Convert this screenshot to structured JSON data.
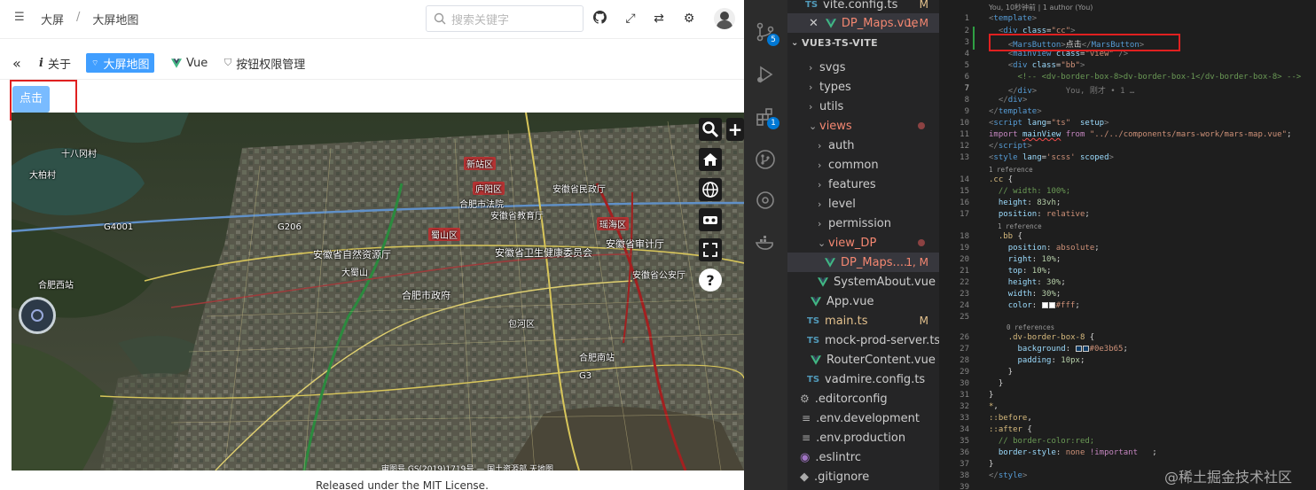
{
  "app": {
    "breadcrumb": [
      "大屏",
      "大屏地图"
    ],
    "search_placeholder": "搜索关键字",
    "tabs": [
      {
        "label": "关于",
        "icon": "info-icon"
      },
      {
        "label": "大屏地图",
        "icon": "dashboard-icon",
        "active": true
      },
      {
        "label": "Vue",
        "icon": "vue-icon"
      },
      {
        "label": "按钮权限管理",
        "icon": "shield-icon"
      }
    ],
    "click_button": "点击",
    "footer": "Released under the MIT License.",
    "accent": "#409eff"
  },
  "map": {
    "labels": [
      "新站区",
      "庐阳区",
      "瑶海区",
      "蜀山区",
      "合肥市政府",
      "合肥市法院",
      "安徽省自然资源厅",
      "安徽省卫生健康委员会",
      "安徽省审计厅",
      "安徽省民政厅",
      "安徽省公安厅",
      "安徽省教育厅",
      "大蜀山",
      "合肥西站",
      "合肥南站",
      "包河区",
      "十八冈村",
      "大柏村",
      "G4001",
      "G206",
      "G3"
    ],
    "credit": "审图号 GS(2019)1719号 — 国土资源部 天地图"
  },
  "vscode": {
    "activity_badges": [
      "5",
      "1"
    ],
    "open_editors": [
      {
        "name": "vite.config.ts",
        "status": "M"
      },
      {
        "name": "DP_Maps.vue",
        "status": "1, M"
      }
    ],
    "project": "VUE3-TS-VITE",
    "tree": [
      {
        "name": "svgs",
        "type": "folder"
      },
      {
        "name": "types",
        "type": "folder"
      },
      {
        "name": "utils",
        "type": "folder"
      },
      {
        "name": "views",
        "type": "folder-open",
        "dirty": true
      },
      {
        "name": "auth",
        "type": "folder"
      },
      {
        "name": "common",
        "type": "folder"
      },
      {
        "name": "features",
        "type": "folder"
      },
      {
        "name": "level",
        "type": "folder"
      },
      {
        "name": "permission",
        "type": "folder"
      },
      {
        "name": "view_DP",
        "type": "folder-open",
        "dirty": true
      },
      {
        "name": "DP_Maps....",
        "type": "vue",
        "status": "1, M"
      },
      {
        "name": "SystemAbout.vue",
        "type": "vue"
      },
      {
        "name": "App.vue",
        "type": "vue"
      },
      {
        "name": "main.ts",
        "type": "ts",
        "status": "M"
      },
      {
        "name": "mock-prod-server.ts",
        "type": "ts"
      },
      {
        "name": "RouterContent.vue",
        "type": "vue"
      },
      {
        "name": "vadmire.config.ts",
        "type": "ts"
      },
      {
        "name": ".editorconfig",
        "type": "gear"
      },
      {
        "name": ".env.development",
        "type": "env"
      },
      {
        "name": ".env.production",
        "type": "env"
      },
      {
        "name": ".eslintrc",
        "type": "eslint"
      },
      {
        "name": ".gitignore",
        "type": "git"
      }
    ],
    "git_blame": "You, 10秒钟前 | 1 author (You)",
    "inline_blame": "You, 刚才 • 1 …",
    "references": [
      "1 reference",
      "1 reference",
      "0 references"
    ],
    "line_numbers": [
      "1",
      "2",
      "3",
      "4",
      "5",
      "6",
      "7",
      "8",
      "9",
      "10",
      "11",
      "12",
      "13",
      "14",
      "15",
      "16",
      "17",
      "18",
      "19",
      "20",
      "21",
      "22",
      "23",
      "24",
      "25",
      "26",
      "27",
      "28",
      "29",
      "30",
      "31",
      "32",
      "33",
      "34",
      "35",
      "36",
      "37",
      "38",
      "39"
    ]
  },
  "watermark": "@稀土掘金技术社区",
  "colors": {
    "highlight_box": "#e02020",
    "button": "#79bbff",
    "vscode_bg": "#1e1e1e"
  }
}
